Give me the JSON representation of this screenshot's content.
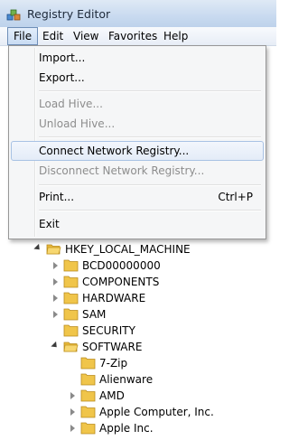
{
  "window": {
    "title": "Registry Editor"
  },
  "menubar": {
    "items": [
      {
        "label": "File",
        "active": true
      },
      {
        "label": "Edit"
      },
      {
        "label": "View"
      },
      {
        "label": "Favorites"
      },
      {
        "label": "Help"
      }
    ]
  },
  "file_menu": {
    "items": [
      {
        "label": "Import...",
        "enabled": true
      },
      {
        "label": "Export...",
        "enabled": true
      },
      {
        "label": "Load Hive...",
        "enabled": false
      },
      {
        "label": "Unload Hive...",
        "enabled": false
      },
      {
        "label": "Connect Network Registry...",
        "enabled": true,
        "highlighted": true
      },
      {
        "label": "Disconnect Network Registry...",
        "enabled": false
      },
      {
        "label": "Print...",
        "shortcut": "Ctrl+P",
        "enabled": true
      },
      {
        "label": "Exit",
        "enabled": true
      }
    ]
  },
  "tree": {
    "root": {
      "label": "HKEY_LOCAL_MACHINE",
      "expanded": true
    },
    "children": [
      {
        "label": "BCD00000000",
        "expanded": false
      },
      {
        "label": "COMPONENTS",
        "expanded": false
      },
      {
        "label": "HARDWARE",
        "expanded": false
      },
      {
        "label": "SAM",
        "expanded": false
      },
      {
        "label": "SECURITY",
        "expanded": false
      },
      {
        "label": "SOFTWARE",
        "expanded": true
      }
    ],
    "software_children": [
      {
        "label": "7-Zip"
      },
      {
        "label": "Alienware"
      },
      {
        "label": "AMD"
      },
      {
        "label": "Apple Computer, Inc."
      },
      {
        "label": "Apple Inc."
      }
    ]
  },
  "colors": {
    "folder": "#f0c54a",
    "titlebar": "#c7d9ef",
    "menu_highlight_border": "#a8c2e4",
    "disabled_text": "#8d8d8d"
  }
}
